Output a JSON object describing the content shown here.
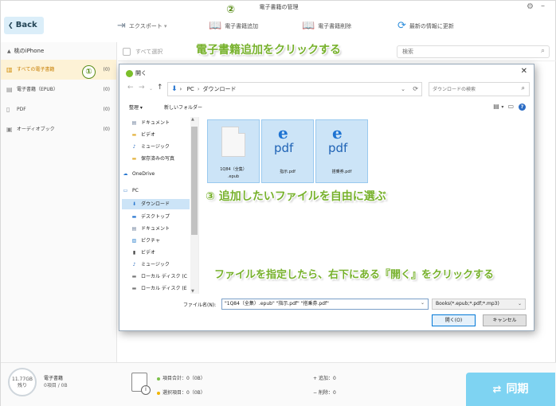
{
  "app": {
    "window_title": "電子書籍の管理",
    "back_label": "Back",
    "toolbar": {
      "export_label": "エクスポート",
      "add_label": "電子書籍追加",
      "delete_label": "電子書籍削除",
      "refresh_label": "最新の情報に更新"
    },
    "sidebar": {
      "device_label": "桃のiPhone",
      "items": [
        {
          "label": "すべての電子書籍",
          "count": "(0)"
        },
        {
          "label": "電子書籍（EPUB）",
          "count": "(0)"
        },
        {
          "label": "PDF",
          "count": "(0)"
        },
        {
          "label": "オーディオブック",
          "count": "(0)"
        }
      ]
    },
    "select_all_label": "すべて選択",
    "search_placeholder": "検索",
    "status": {
      "capacity": "11.77GB",
      "capacity_sub": "残り",
      "ebook_label": "電子書籍",
      "ebook_detail": "0項目 / 0B",
      "total_items": "項目合計：0（0B）",
      "selected_items": "選択項目：0（0B）",
      "added": "追加：0",
      "deleted": "削除：0"
    },
    "sync_label": "同期",
    "accent_color": "#7ed3f2"
  },
  "dialog": {
    "title": "開く",
    "breadcrumb": [
      "PC",
      "ダウンロード"
    ],
    "search_placeholder": "ダウンロードの検索",
    "organize_label": "整理 ▾",
    "new_folder_label": "新しいフォルダー",
    "nav_items": [
      {
        "label": "ドキュメント",
        "icon": "document-icon"
      },
      {
        "label": "ビデオ",
        "icon": "video-icon"
      },
      {
        "label": "ミュージック",
        "icon": "music-icon"
      },
      {
        "label": "保存済みの写真",
        "icon": "folder-icon"
      },
      {
        "label": "OneDrive",
        "icon": "cloud-icon"
      },
      {
        "label": "PC",
        "icon": "pc-icon"
      },
      {
        "label": "ダウンロード",
        "icon": "download-icon"
      },
      {
        "label": "デスクトップ",
        "icon": "desktop-icon"
      },
      {
        "label": "ドキュメント",
        "icon": "document-icon"
      },
      {
        "label": "ピクチャ",
        "icon": "picture-icon"
      },
      {
        "label": "ビデオ",
        "icon": "video-icon"
      },
      {
        "label": "ミュージック",
        "icon": "music-icon"
      },
      {
        "label": "ローカル ディスク (C",
        "icon": "disk-icon"
      },
      {
        "label": "ローカル ディスク (E",
        "icon": "disk-icon"
      }
    ],
    "files": [
      {
        "name": "1Q84（全集）.epub",
        "line1": "1Q84（全集）",
        "line2": ".epub"
      },
      {
        "name": "指示.pdf",
        "line1": "指示.pdf",
        "line2": ""
      },
      {
        "name": "搭乗券.pdf",
        "line1": "搭乗券.pdf",
        "line2": ""
      }
    ],
    "pdf_icon_text": "pdf",
    "pdf_icon_letter": "e",
    "filename_label": "ファイル名(N):",
    "filename_value": "\"1Q84（全集）.epub\" \"指示.pdf\" \"搭乗券.pdf\"",
    "filetype_value": "Books(*.epub;*.pdf;*.mp3)",
    "open_label": "開く(O)",
    "cancel_label": "キャンセル"
  },
  "annotations": {
    "step1_num": "①",
    "step2_num": "②",
    "step1_text": "電子書籍追加をクリックする",
    "step3_text": "③ 追加したいファイルを自由に選ぶ",
    "step4_text": "ファイルを指定したら、右下にある『開く』をクリックする",
    "color": "#77b12c"
  }
}
